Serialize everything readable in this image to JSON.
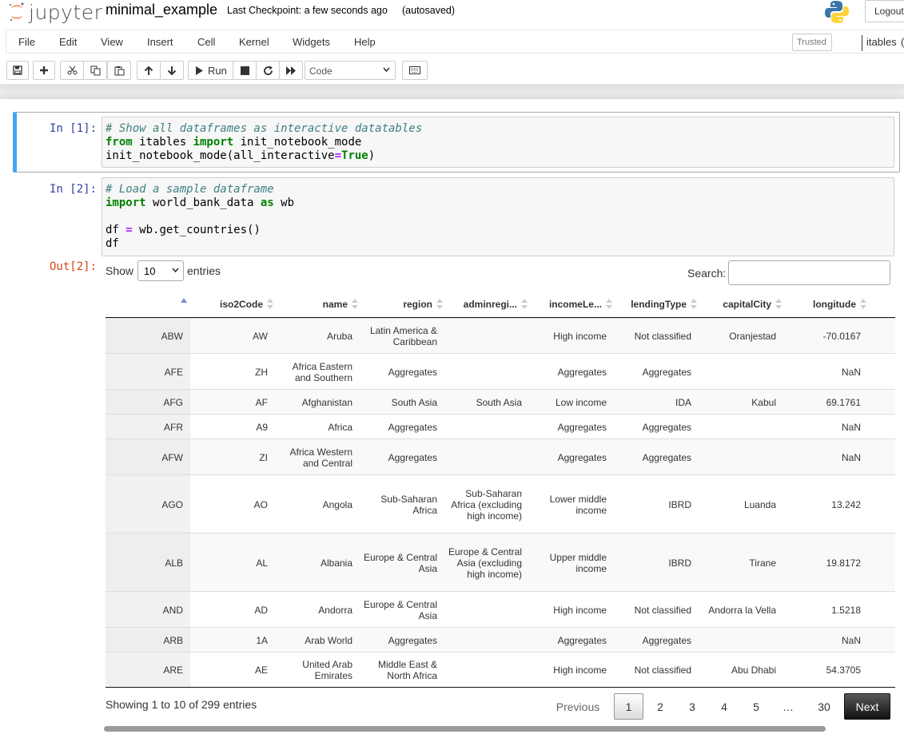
{
  "header": {
    "logo_text": "jupyter",
    "notebook_name": "minimal_example",
    "checkpoint": "Last Checkpoint: a few seconds ago",
    "autosave": "(autosaved)",
    "logout_label": "Logout"
  },
  "menubar": {
    "items": [
      "File",
      "Edit",
      "View",
      "Insert",
      "Cell",
      "Kernel",
      "Widgets",
      "Help"
    ],
    "trusted_label": "Trusted",
    "kernel_name": "itables",
    "kernel_indicator": "("
  },
  "toolbar": {
    "run_label": "Run",
    "cell_type": "Code"
  },
  "cells": {
    "cell1": {
      "prompt": "In [1]:",
      "lines": {
        "l1_comment": "# Show all dataframes as interactive datatables",
        "l2_from": "from",
        "l2_mod": " itables ",
        "l2_import": "import",
        "l2_rest": " init_notebook_mode",
        "l3_pre": "init_notebook_mode(all_interactive",
        "l3_eq": "=",
        "l3_true": "True",
        "l3_post": ")"
      }
    },
    "cell2": {
      "prompt": "In [2]:",
      "out_prompt": "Out[2]:",
      "lines": {
        "l1_comment": "# Load a sample dataframe",
        "l2_import": "import",
        "l2_mod": " world_bank_data ",
        "l2_as": "as",
        "l2_rest": " wb",
        "l4_pre": "df ",
        "l4_eq": "=",
        "l4_post": " wb.get_countries()",
        "l5": "df"
      }
    }
  },
  "datatable": {
    "show_label": "Show",
    "length_value": "10",
    "entries_label": "entries",
    "search_label": "Search:",
    "search_value": "",
    "columns": [
      "",
      "iso2Code",
      "name",
      "region",
      "adminregi...",
      "incomeLe...",
      "lendingType",
      "capitalCity",
      "longitude"
    ],
    "rows": [
      [
        "ABW",
        "AW",
        "Aruba",
        "Latin America & Caribbean",
        "",
        "High income",
        "Not classified",
        "Oranjestad",
        "-70.0167"
      ],
      [
        "AFE",
        "ZH",
        "Africa Eastern and Southern",
        "Aggregates",
        "",
        "Aggregates",
        "Aggregates",
        "",
        "NaN"
      ],
      [
        "AFG",
        "AF",
        "Afghanistan",
        "South Asia",
        "South Asia",
        "Low income",
        "IDA",
        "Kabul",
        "69.1761"
      ],
      [
        "AFR",
        "A9",
        "Africa",
        "Aggregates",
        "",
        "Aggregates",
        "Aggregates",
        "",
        "NaN"
      ],
      [
        "AFW",
        "ZI",
        "Africa Western and Central",
        "Aggregates",
        "",
        "Aggregates",
        "Aggregates",
        "",
        "NaN"
      ],
      [
        "AGO",
        "AO",
        "Angola",
        "Sub-Saharan Africa",
        "Sub-Saharan Africa (excluding high income)",
        "Lower middle income",
        "IBRD",
        "Luanda",
        "13.242"
      ],
      [
        "ALB",
        "AL",
        "Albania",
        "Europe & Central Asia",
        "Europe & Central Asia (excluding high income)",
        "Upper middle income",
        "IBRD",
        "Tirane",
        "19.8172"
      ],
      [
        "AND",
        "AD",
        "Andorra",
        "Europe & Central Asia",
        "",
        "High income",
        "Not classified",
        "Andorra la Vella",
        "1.5218"
      ],
      [
        "ARB",
        "1A",
        "Arab World",
        "Aggregates",
        "",
        "Aggregates",
        "Aggregates",
        "",
        "NaN"
      ],
      [
        "ARE",
        "AE",
        "United Arab Emirates",
        "Middle East & North Africa",
        "",
        "High income",
        "Not classified",
        "Abu Dhabi",
        "54.3705"
      ]
    ],
    "info": "Showing 1 to 10 of 299 entries",
    "pagination": {
      "previous": "Previous",
      "pages": [
        "1",
        "2",
        "3",
        "4",
        "5",
        "…",
        "30"
      ],
      "next": "Next",
      "current": "1"
    }
  }
}
